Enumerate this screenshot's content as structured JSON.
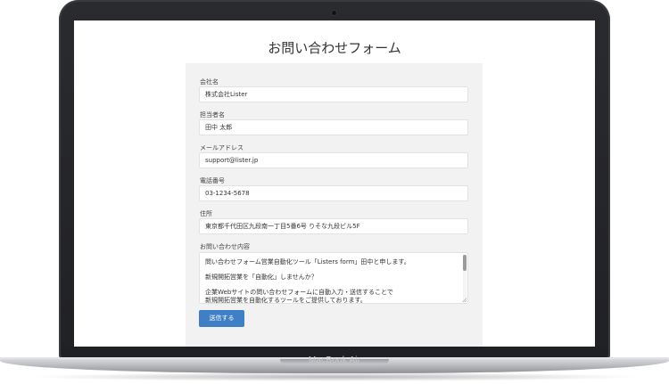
{
  "device": {
    "brand_label": "MacBook Air"
  },
  "page": {
    "title": "お問い合わせフォーム"
  },
  "form": {
    "fields": [
      {
        "label": "会社名",
        "value": "株式会社Lister"
      },
      {
        "label": "担当者名",
        "value": "田中 太郎"
      },
      {
        "label": "メールアドレス",
        "value": "support@lister.jp"
      },
      {
        "label": "電話番号",
        "value": "03-1234-5678"
      },
      {
        "label": "住所",
        "value": "東京都千代田区九段南一丁目5番6号 りそな九段ビル5F"
      }
    ],
    "message": {
      "label": "お問い合わせ内容",
      "lines": [
        "問い合わせフォーム営業自動化ツール「Listers form」田中と申します。",
        "新規開拓営業を「自動化」しませんか？",
        "企業Webサイトの問い合わせフォームに自動入力・送信することで",
        "新規開拓営業を自動化するツールをご提供しております。"
      ]
    },
    "submit_label": "送信する"
  }
}
